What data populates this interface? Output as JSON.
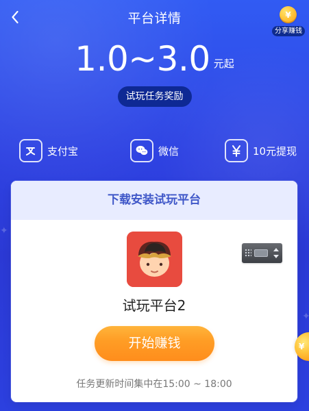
{
  "header": {
    "title": "平台详情",
    "back_icon": "chevron-left-icon",
    "share_coin_icon": "coin-icon",
    "share_coin_symbol": "¥",
    "share_label": "分享赚钱"
  },
  "reward": {
    "range": "1.0~3.0",
    "unit": "元起",
    "badge": "试玩任务奖励"
  },
  "features": [
    {
      "icon": "alipay-icon",
      "label": "支付宝"
    },
    {
      "icon": "wechat-icon",
      "label": "微信"
    },
    {
      "icon": "yen-icon",
      "label": "10元提现"
    }
  ],
  "task_card": {
    "title": "下载安装试玩平台",
    "app_name": "试玩平台2",
    "start_button": "开始赚钱",
    "update_time": "任务更新时间集中在15:00 ~ 18:00"
  },
  "floating": {
    "coin_symbol": "¥"
  },
  "colors": {
    "background": "#2f47e6",
    "accent_orange": "#ff9d25",
    "card_header": "#e8ecff",
    "app_icon": "#e84b3f"
  }
}
